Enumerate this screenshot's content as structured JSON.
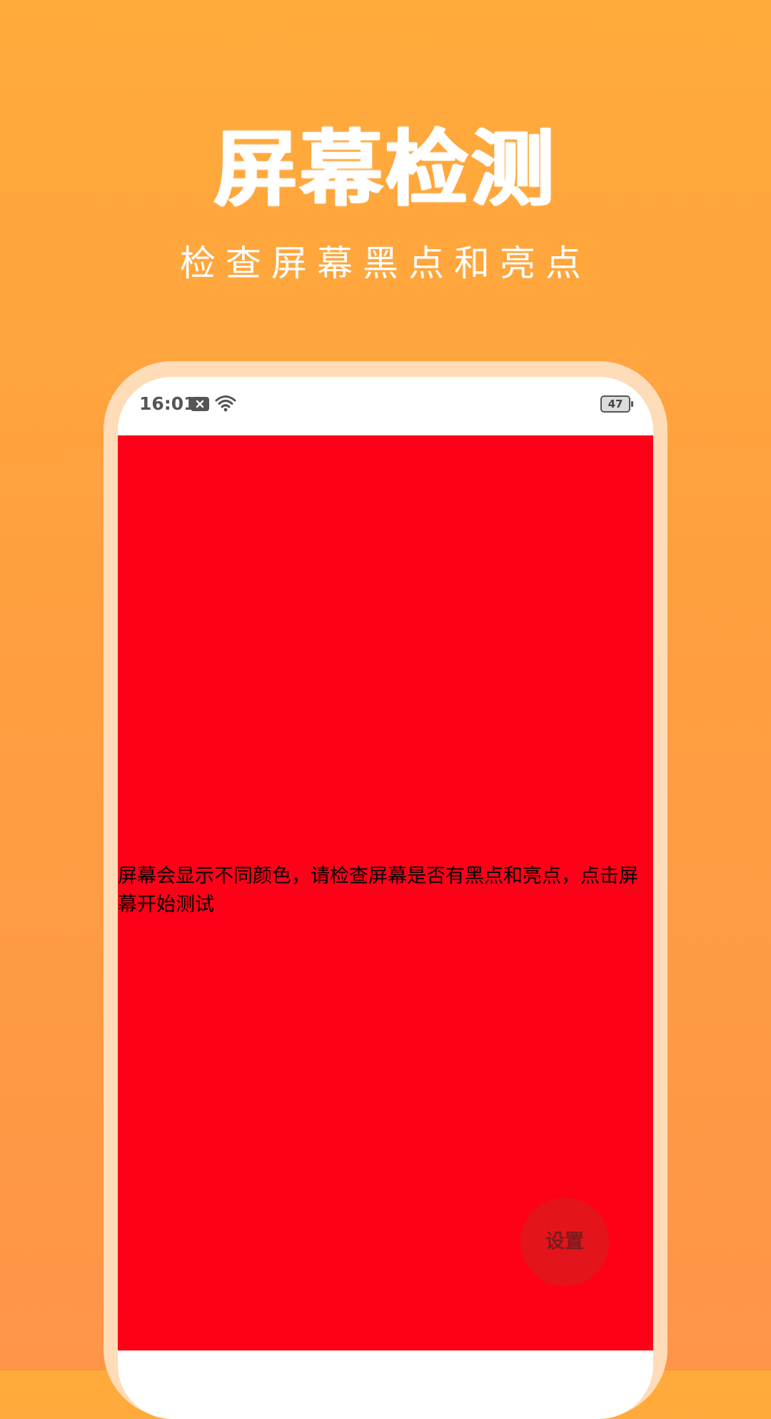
{
  "hero": {
    "title": "屏幕检测",
    "subtitle": "检查屏幕黑点和亮点"
  },
  "status_bar": {
    "time": "16:01",
    "battery_level": "47",
    "icons": [
      "notification-x-icon",
      "wifi-icon",
      "battery-icon"
    ]
  },
  "test_screen": {
    "color": "#ff0019",
    "instruction": "屏幕会显示不同颜色，请检查屏幕是否有黑点和亮点，点击屏幕开始测试"
  },
  "settings": {
    "label": "设置"
  },
  "colors": {
    "background_top": "#ffab3b",
    "background_bottom": "#ff9548",
    "phone_frame": "#ffdcb8",
    "test_red": "#ff0019"
  }
}
